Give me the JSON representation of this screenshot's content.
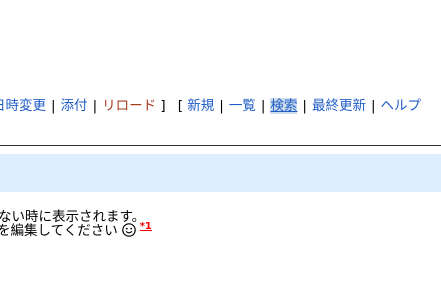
{
  "toolbar": {
    "items": [
      {
        "label": "日時変更"
      },
      {
        "label": "添付"
      },
      {
        "label": "リロード"
      }
    ],
    "close_bracket": "]",
    "open_bracket": "[",
    "separator": "|",
    "items2": [
      {
        "label": "新規"
      },
      {
        "label": "一覧"
      },
      {
        "label": "検索"
      },
      {
        "label": "最終更新"
      },
      {
        "label": "ヘルプ"
      }
    ]
  },
  "content": {
    "line1": "ない時に表示されます。",
    "line2": "を編集してください",
    "footnote_mark": "*1"
  },
  "colors": {
    "link": "#215dc6",
    "visited_link": "#a63d21",
    "title_bar_bg": "#ddeeff",
    "footnote": "#ff0000"
  },
  "icons": {
    "smiley": "smiley-face-icon"
  }
}
